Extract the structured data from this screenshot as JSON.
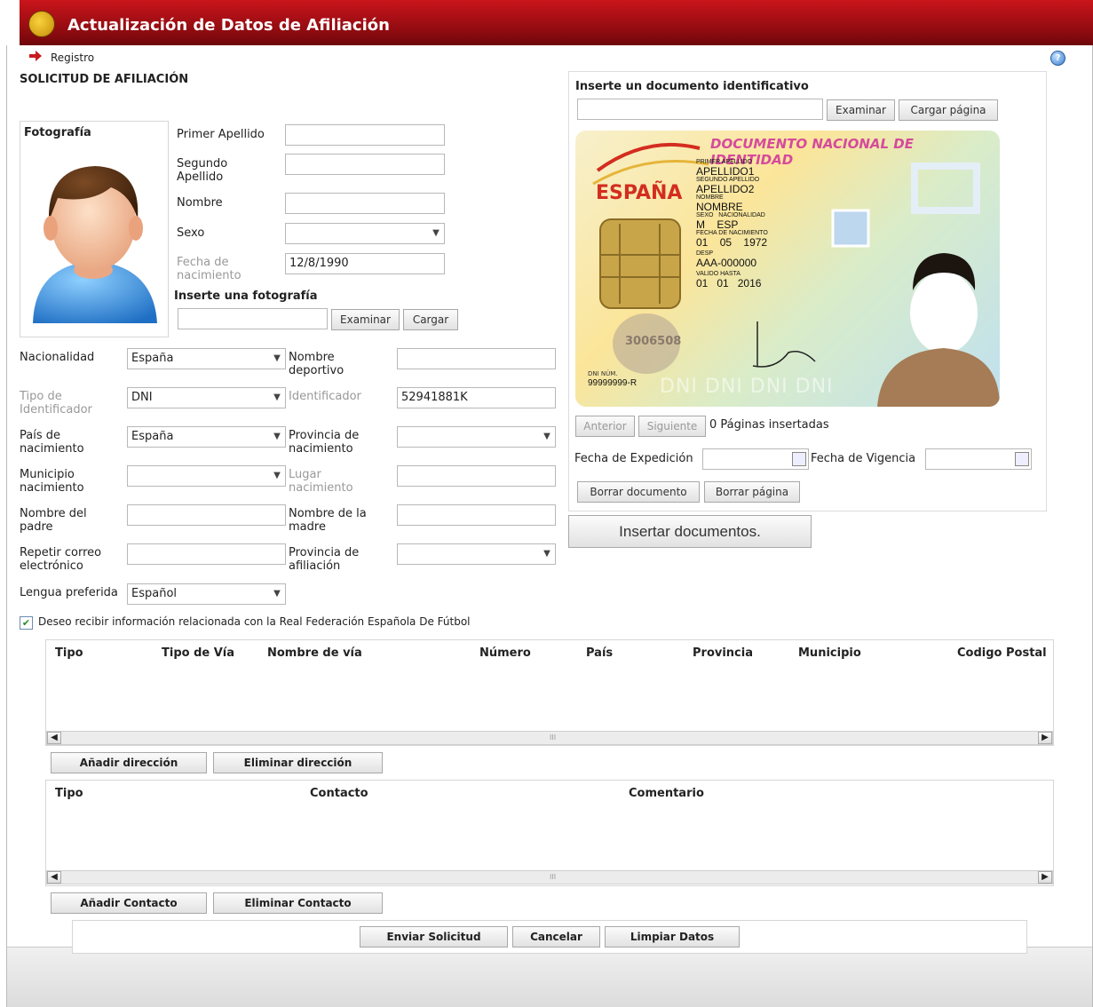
{
  "header": {
    "title": "Actualización de Datos de Afiliación"
  },
  "breadcrumb": {
    "item": "Registro"
  },
  "form": {
    "title": "SOLICITUD DE AFILIACIÓN",
    "photo_label": "Fotografía",
    "primer_apellido_label": "Primer Apellido",
    "segundo_apellido_label": "Segundo Apellido",
    "nombre_label": "Nombre",
    "sexo_label": "Sexo",
    "fecha_nacimiento_label": "Fecha de nacimiento",
    "fecha_nacimiento_value": "12/8/1990",
    "insert_photo_label": "Inserte una fotografía",
    "examinar_label": "Examinar",
    "cargar_label": "Cargar",
    "nacionalidad_label": "Nacionalidad",
    "nacionalidad_value": "España",
    "nombre_deportivo_label": "Nombre deportivo",
    "tipo_identificador_label": "Tipo de Identificador",
    "tipo_identificador_value": "DNI",
    "identificador_label": "Identificador",
    "identificador_value": "52941881K",
    "pais_nacimiento_label": "País de nacimiento",
    "pais_nacimiento_value": "España",
    "provincia_nacimiento_label": "Provincia de nacimiento",
    "municipio_nacimiento_label": "Municipio nacimiento",
    "lugar_nacimiento_label": "Lugar nacimiento",
    "nombre_padre_label": "Nombre del padre",
    "nombre_madre_label": "Nombre de la madre",
    "repetir_correo_label": "Repetir correo electrónico",
    "provincia_afiliacion_label": "Provincia de afiliación",
    "lengua_label": "Lengua preferida",
    "lengua_value": "Español",
    "checkbox_label": "Deseo recibir información relacionada con la Real Federación Española De Fútbol"
  },
  "document": {
    "title": "Inserte un documento identificativo",
    "examinar_label": "Examinar",
    "cargar_pagina_label": "Cargar página",
    "card": {
      "header": "DOCUMENTO NACIONAL DE IDENTIDAD",
      "country": "ESPAÑA",
      "primer_apellido_caption": "PRIMER APELLIDO",
      "primer_apellido": "APELLIDO1",
      "segundo_apellido_caption": "SEGUNDO APELLIDO",
      "segundo_apellido": "APELLIDO2",
      "nombre_caption": "NOMBRE",
      "nombre": "NOMBRE",
      "sexo_caption": "SEXO",
      "nacionalidad_caption": "NACIONALIDAD",
      "sexo": "M",
      "nacionalidad": "ESP",
      "fecha_caption": "FECHA DE NACIMIENTO",
      "fecha_dia": "01",
      "fecha_mes": "05",
      "fecha_anio": "1972",
      "desp_caption": "DESP",
      "desp": "AAA-000000",
      "valido_caption": "VALIDO HASTA",
      "valido_dia": "01",
      "valido_mes": "01",
      "valido_anio": "2016",
      "number_watermark": "3006508",
      "dni_caption": "DNI NÚM.",
      "dni_num": "99999999-R",
      "background_text": "DNI DNI DNI DNI"
    },
    "anterior_label": "Anterior",
    "siguiente_label": "Siguiente",
    "pages_text": "0 Páginas insertadas",
    "fecha_expedicion_label": "Fecha de Expedición",
    "fecha_vigencia_label": "Fecha de Vigencia",
    "borrar_documento_label": "Borrar documento",
    "borrar_pagina_label": "Borrar página",
    "insertar_label": "Insertar documentos."
  },
  "address_table": {
    "columns": [
      "Tipo",
      "Tipo de Vía",
      "Nombre de vía",
      "Número",
      "País",
      "Provincia",
      "Municipio",
      "Codigo Postal"
    ],
    "add_label": "Añadir dirección",
    "remove_label": "Eliminar dirección"
  },
  "contact_table": {
    "columns": [
      "Tipo",
      "Contacto",
      "Comentario"
    ],
    "add_label": "Añadir Contacto",
    "remove_label": "Eliminar Contacto"
  },
  "actions": {
    "enviar_label": "Enviar Solicitud",
    "cancelar_label": "Cancelar",
    "limpiar_label": "Limpiar Datos"
  },
  "icons": {
    "header_logo": "rfef-logo-icon",
    "breadcrumb_arrow": "red-arrow-right-icon",
    "help": "help-icon",
    "scroll_left": "◀",
    "scroll_right": "▶",
    "scroll_grip": "III",
    "calendar": "calendar-icon",
    "checkbox": "✔",
    "dropdown": "▼"
  },
  "colors": {
    "header": "#b0141a",
    "accent_red": "#c8191f"
  }
}
